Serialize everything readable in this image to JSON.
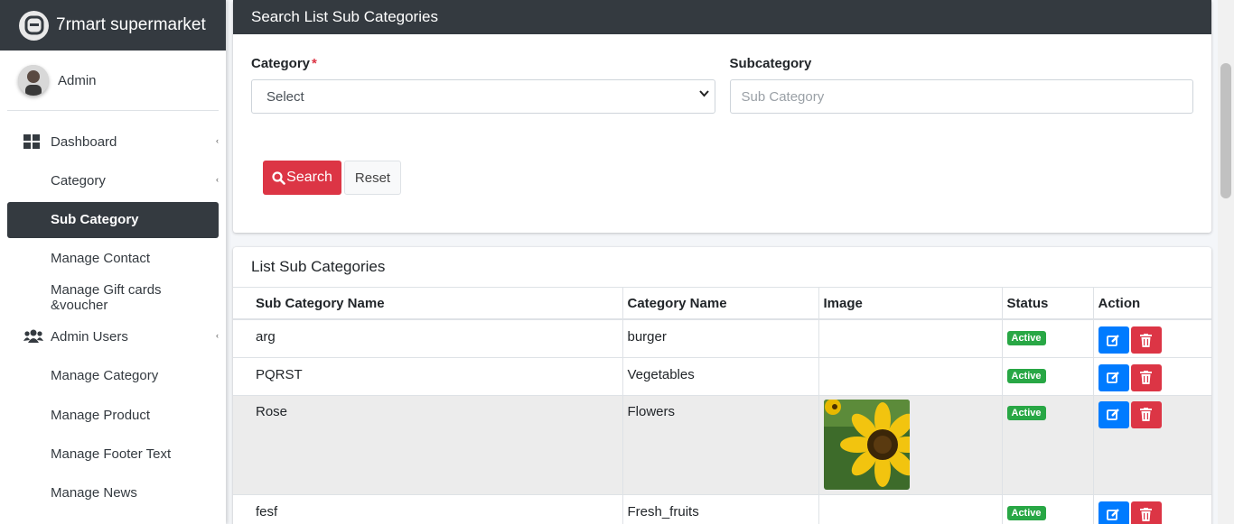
{
  "brand": {
    "title": "7rmart supermarket"
  },
  "user": {
    "name": "Admin"
  },
  "sidebar": {
    "items": [
      {
        "label": "Dashboard",
        "icon": "dashboard-icon",
        "top": true,
        "caret": true
      },
      {
        "label": "Category",
        "caret": true
      },
      {
        "label": "Sub Category",
        "active": true
      },
      {
        "label": "Manage Contact"
      },
      {
        "label": "Manage Gift cards &voucher"
      },
      {
        "label": "Admin Users",
        "icon": "users-icon",
        "top": true,
        "caret": true
      },
      {
        "label": "Manage Category"
      },
      {
        "label": "Manage Product"
      },
      {
        "label": "Manage Footer Text"
      },
      {
        "label": "Manage News"
      }
    ]
  },
  "search_card": {
    "title": "Search List Sub Categories",
    "category_label": "Category",
    "required_mark": "*",
    "category_value": "Select",
    "subcategory_label": "Subcategory",
    "subcategory_placeholder": "Sub Category",
    "search_button": "Search",
    "reset_button": "Reset"
  },
  "list_card": {
    "title": "List Sub Categories",
    "columns": [
      "Sub Category Name",
      "Category Name",
      "Image",
      "Status",
      "Action"
    ],
    "rows": [
      {
        "sub_category": "arg",
        "category": "burger",
        "has_image": false,
        "status": "Active"
      },
      {
        "sub_category": "PQRST",
        "category": "Vegetables",
        "has_image": false,
        "status": "Active"
      },
      {
        "sub_category": "Rose",
        "category": "Flowers",
        "has_image": true,
        "status": "Active"
      },
      {
        "sub_category": "fesf",
        "category": "Fresh_fruits",
        "has_image": false,
        "status": "Active"
      }
    ]
  },
  "colors": {
    "header_dark": "#343a40",
    "danger": "#dc3545",
    "primary": "#007bff",
    "success": "#28a745"
  }
}
